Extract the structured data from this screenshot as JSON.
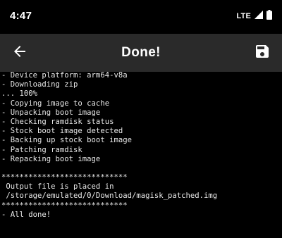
{
  "status_bar": {
    "time": "4:47",
    "network": "LTE",
    "icons": [
      "signal-icon",
      "battery-icon"
    ]
  },
  "toolbar": {
    "title": "Done!",
    "back_icon": "arrow-back-icon",
    "save_icon": "save-icon"
  },
  "console": {
    "lines": [
      "- Device platform: arm64-v8a",
      "- Downloading zip",
      "... 100%",
      "- Copying image to cache",
      "- Unpacking boot image",
      "- Checking ramdisk status",
      "- Stock boot image detected",
      "- Backing up stock boot image",
      "- Patching ramdisk",
      "- Repacking boot image",
      "",
      "****************************",
      " Output file is placed in",
      " /storage/emulated/0/Download/magisk_patched.img",
      "****************************",
      "- All done!"
    ]
  },
  "colors": {
    "background": "#000000",
    "toolbar": "#2a2a2a",
    "text": "#e8e8e8"
  }
}
